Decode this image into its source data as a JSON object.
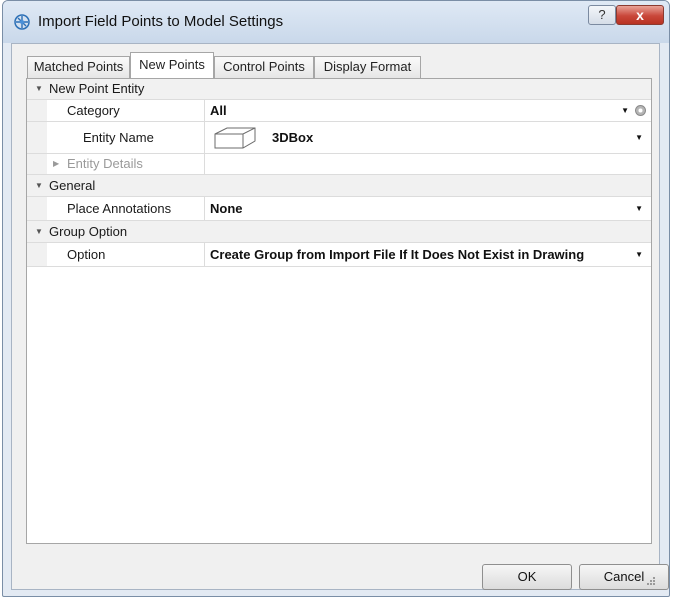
{
  "window": {
    "title": "Import Field Points to Model Settings",
    "help_label": "?",
    "close_label": "x"
  },
  "tabs": [
    {
      "label": "Matched Points",
      "active": false
    },
    {
      "label": "New Points",
      "active": true
    },
    {
      "label": "Control Points",
      "active": false
    },
    {
      "label": "Display Format",
      "active": false
    }
  ],
  "sections": {
    "new_point_entity": {
      "label": "New Point Entity",
      "category": {
        "label": "Category",
        "value": "All"
      },
      "entity_name": {
        "label": "Entity Name",
        "value": "3DBox",
        "icon": "cube-icon"
      },
      "entity_details": {
        "label": "Entity Details"
      }
    },
    "general": {
      "label": "General",
      "place_annotations": {
        "label": "Place Annotations",
        "value": "None"
      }
    },
    "group_option": {
      "label": "Group Option",
      "option": {
        "label": "Option",
        "value": "Create Group from Import File If It Does Not Exist in Drawing"
      }
    }
  },
  "buttons": {
    "ok": "OK",
    "cancel": "Cancel"
  }
}
